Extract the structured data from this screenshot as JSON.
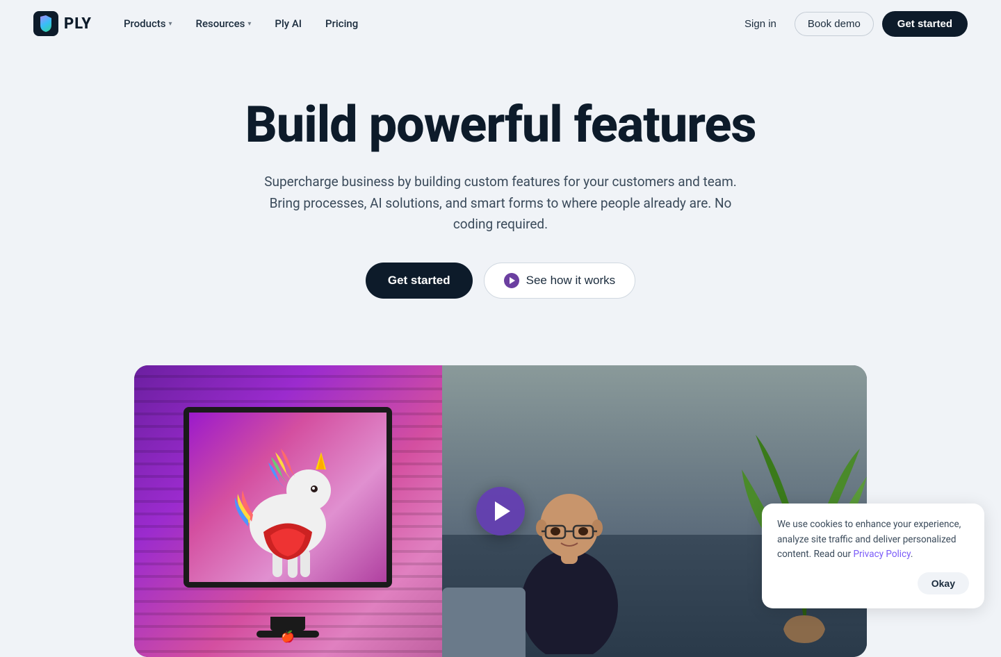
{
  "brand": {
    "logo_text": "PLY",
    "logo_icon_alt": "ply-logo"
  },
  "nav": {
    "links": [
      {
        "label": "Products",
        "has_dropdown": true
      },
      {
        "label": "Resources",
        "has_dropdown": true
      },
      {
        "label": "Ply AI",
        "has_dropdown": false
      },
      {
        "label": "Pricing",
        "has_dropdown": false
      }
    ],
    "signin_label": "Sign in",
    "book_demo_label": "Book demo",
    "get_started_label": "Get started"
  },
  "hero": {
    "title": "Build powerful features",
    "subtitle": "Supercharge business by building custom features for your customers and team. Bring processes, AI solutions, and smart forms to where people already are. No coding required.",
    "cta_primary": "Get started",
    "cta_secondary": "See how it works"
  },
  "video": {
    "play_label": "Play video"
  },
  "cookie": {
    "text": "We use cookies to enhance your experience, analyze site traffic and deliver personalized content. Read our",
    "link_text": "Privacy Policy",
    "link_suffix": ".",
    "okay_label": "Okay"
  }
}
